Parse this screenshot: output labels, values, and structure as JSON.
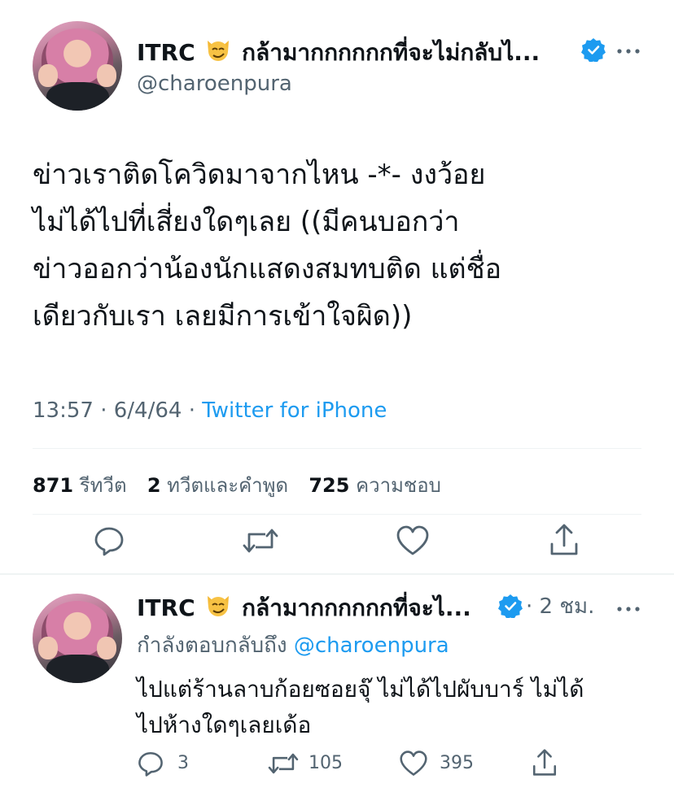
{
  "main_tweet": {
    "display_name": "ITRC",
    "name_suffix": "กล้ามากกกกกกที่จะไม่กลับไ...",
    "handle": "@charoenpura",
    "text_lines": [
      "ข่าวเราติดโควิดมาจากไหน -*- งงว้อย",
      "ไม่ได้ไปที่เสี่ยงใดๆเลย ((มีคนบอกว่า",
      "ข่าวออกว่าน้องนักแสดงสมทบติด แต่ชื่อ",
      "เดียวกับเรา  เลยมีการเข้าใจผิด))"
    ],
    "time": "13:57",
    "date": "6/4/64",
    "source": "Twitter for iPhone",
    "retweets_count": "871",
    "retweets_label": "รีทวีต",
    "quotes_count": "2",
    "quotes_label": "ทวีตและคำพูด",
    "likes_count": "725",
    "likes_label": "ความชอบ"
  },
  "reply_tweet": {
    "display_name": "ITRC",
    "name_suffix": "กล้ามากกกกกกที่จะไ...",
    "time_ago": "2 ชม.",
    "replying_label": "กำลังตอบกลับถึง",
    "replying_handle": "@charoenpura",
    "text_lines": [
      "ไปแต่ร้านลาบก้อยซอยจุ๊ ไม่ได้ไปผับบาร์ ไม่ได้",
      "ไปห้างใดๆเลยเด้อ"
    ],
    "reply_count": "3",
    "retweet_count": "105",
    "like_count": "395"
  },
  "colors": {
    "accent": "#1d9bf0",
    "muted": "#536471",
    "text": "#0f1419",
    "divider": "#eff3f4"
  }
}
